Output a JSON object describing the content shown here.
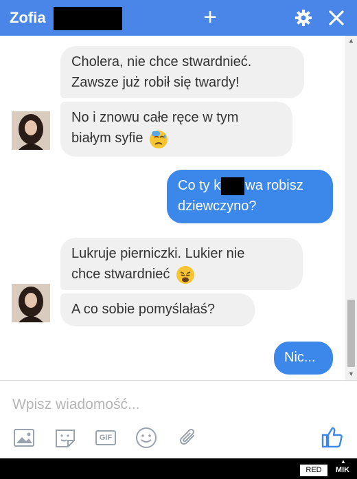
{
  "header": {
    "name": "Zofia",
    "plus_icon": "plus-icon",
    "gear_icon": "gear-icon",
    "close_icon": "close-icon",
    "color": "#4a86e8"
  },
  "messages": [
    {
      "from": "them",
      "text": "Cholera, nie chce stwardnieć."
    },
    {
      "from": "them",
      "text": "Zawsze już robił się twardy!"
    },
    {
      "from": "them",
      "text": "No i znowu całe ręce w tym"
    },
    {
      "from": "them",
      "text": "białym syfie",
      "emoji": "sweat-face-icon"
    },
    {
      "from": "me",
      "text_a": "Co ty k",
      "text_b": "wa robisz",
      "text_c": "dziewczyno?"
    },
    {
      "from": "them",
      "text": "Lukruje pierniczki. Lukier nie"
    },
    {
      "from": "them",
      "text": "chce stwardnieć",
      "emoji": "weary-face-icon"
    },
    {
      "from": "them",
      "text": "A co sobie pomyślałaś?"
    },
    {
      "from": "me",
      "text": "Nic..."
    }
  ],
  "composer": {
    "placeholder": "Wpisz wiadomość...",
    "tools": [
      "photo-icon",
      "sticker-icon",
      "gif-icon",
      "emoji-icon",
      "attachment-icon"
    ],
    "gif_label": "GIF",
    "like_icon": "thumbs-up-icon"
  },
  "footer": {
    "red": "RED",
    "mik": "MIK"
  },
  "colors": {
    "accent": "#4a86e8",
    "outgoing": "#3b87ea",
    "incoming": "#f1f0f0"
  }
}
